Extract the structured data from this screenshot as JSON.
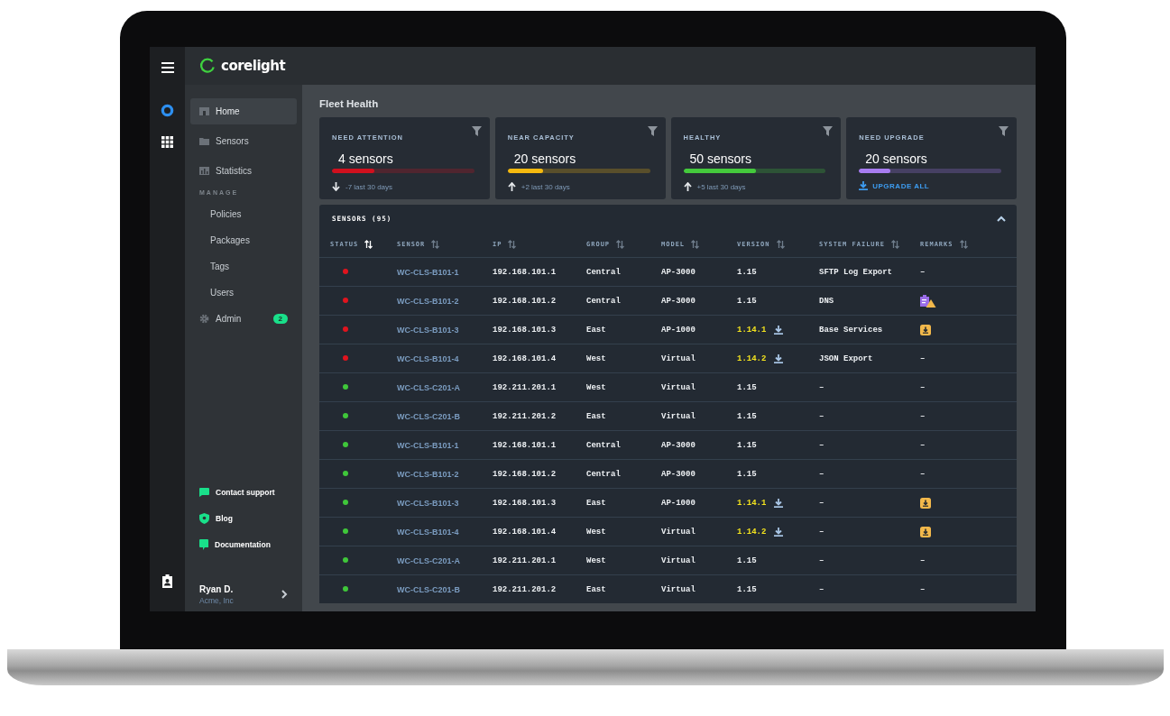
{
  "app": {
    "logo_text": "corelight"
  },
  "sidebar": {
    "items": [
      {
        "kind": "main",
        "label": "Home",
        "selected": true
      },
      {
        "kind": "main",
        "label": "Sensors",
        "selected": false
      },
      {
        "kind": "main",
        "label": "Statistics",
        "selected": false
      },
      {
        "kind": "heading",
        "label": "MANAGE"
      },
      {
        "kind": "sub",
        "label": "Policies",
        "selected": false
      },
      {
        "kind": "sub",
        "label": "Packages",
        "selected": false
      },
      {
        "kind": "sub",
        "label": "Tags",
        "selected": false
      },
      {
        "kind": "sub",
        "label": "Users",
        "selected": false
      },
      {
        "kind": "main",
        "label": "Admin",
        "selected": false,
        "badge": "2"
      }
    ],
    "links": [
      "Contact support",
      "Blog",
      "Documentation"
    ],
    "user": {
      "name": "Ryan D.",
      "org": "Acme, Inc"
    }
  },
  "page_title": "Fleet Health",
  "cards": [
    {
      "title": "NEED ATTENTION",
      "count": "4 sensors",
      "level": 0.3,
      "color": "#d0101e",
      "kind": "trend",
      "rising": false,
      "text": "-7 last 30 days"
    },
    {
      "title": "NEAR CAPACITY",
      "count": "20 sensors",
      "level": 0.25,
      "color": "#f5b90f",
      "kind": "trend",
      "rising": true,
      "text": "+2 last 30 days"
    },
    {
      "title": "HEALTHY",
      "count": "50 sensors",
      "level": 0.51,
      "color": "#44c93c",
      "kind": "trend",
      "rising": true,
      "text": "+5 last 30 days"
    },
    {
      "title": "NEED UPGRADE",
      "count": "20 sensors",
      "level": 0.22,
      "color": "#a77cf0",
      "kind": "action",
      "text": "UPGRADE ALL"
    }
  ],
  "table": {
    "title": "SENSORS (95)",
    "expanded": true,
    "columns": [
      {
        "label": "STATUS",
        "sort_active": true
      },
      {
        "label": "SENSOR",
        "sort_active": false
      },
      {
        "label": "IP",
        "sort_active": false
      },
      {
        "label": "GROUP",
        "sort_active": false
      },
      {
        "label": "MODEL",
        "sort_active": false
      },
      {
        "label": "VERSION",
        "sort_active": false
      },
      {
        "label": "SYSTEM FAILURE",
        "sort_active": false
      },
      {
        "label": "REMARKS",
        "sort_active": false
      }
    ],
    "rows": [
      {
        "color": "#e0141e",
        "sensor": "WC-CLS-B101-1",
        "ip": "192.168.101.1",
        "group": "Central",
        "model": "AP-3000",
        "version": "1.15",
        "outdated": false,
        "failure": "SFTP Log Export",
        "remarks": {
          "kind": "text",
          "text": "–"
        }
      },
      {
        "color": "#e0141e",
        "sensor": "WC-CLS-B101-2",
        "ip": "192.168.101.2",
        "group": "Central",
        "model": "AP-3000",
        "version": "1.15",
        "outdated": false,
        "failure": "DNS",
        "remarks": {
          "kind": "clipboard-warning"
        }
      },
      {
        "color": "#e0141e",
        "sensor": "WC-CLS-B101-3",
        "ip": "192.168.101.3",
        "group": "East",
        "model": "AP-1000",
        "version": "1.14.1",
        "outdated": true,
        "failure": "Base Services",
        "remarks": {
          "kind": "download"
        }
      },
      {
        "color": "#e0141e",
        "sensor": "WC-CLS-B101-4",
        "ip": "192.168.101.4",
        "group": "West",
        "model": "Virtual",
        "version": "1.14.2",
        "outdated": true,
        "failure": "JSON Export",
        "remarks": {
          "kind": "text",
          "text": "–"
        }
      },
      {
        "color": "#3fc73a",
        "sensor": "WC-CLS-C201-A",
        "ip": "192.211.201.1",
        "group": "West",
        "model": "Virtual",
        "version": "1.15",
        "outdated": false,
        "failure": "–",
        "remarks": {
          "kind": "text",
          "text": "–"
        }
      },
      {
        "color": "#3fc73a",
        "sensor": "WC-CLS-C201-B",
        "ip": "192.211.201.2",
        "group": "East",
        "model": "Virtual",
        "version": "1.15",
        "outdated": false,
        "failure": "–",
        "remarks": {
          "kind": "text",
          "text": "–"
        }
      },
      {
        "color": "#3fc73a",
        "sensor": "WC-CLS-B101-1",
        "ip": "192.168.101.1",
        "group": "Central",
        "model": "AP-3000",
        "version": "1.15",
        "outdated": false,
        "failure": "–",
        "remarks": {
          "kind": "text",
          "text": "–"
        }
      },
      {
        "color": "#3fc73a",
        "sensor": "WC-CLS-B101-2",
        "ip": "192.168.101.2",
        "group": "Central",
        "model": "AP-3000",
        "version": "1.15",
        "outdated": false,
        "failure": "–",
        "remarks": {
          "kind": "text",
          "text": "–"
        }
      },
      {
        "color": "#3fc73a",
        "sensor": "WC-CLS-B101-3",
        "ip": "192.168.101.3",
        "group": "East",
        "model": "AP-1000",
        "version": "1.14.1",
        "outdated": true,
        "failure": "–",
        "remarks": {
          "kind": "download"
        }
      },
      {
        "color": "#3fc73a",
        "sensor": "WC-CLS-B101-4",
        "ip": "192.168.101.4",
        "group": "West",
        "model": "Virtual",
        "version": "1.14.2",
        "outdated": true,
        "failure": "–",
        "remarks": {
          "kind": "download"
        }
      },
      {
        "color": "#3fc73a",
        "sensor": "WC-CLS-C201-A",
        "ip": "192.211.201.1",
        "group": "West",
        "model": "Virtual",
        "version": "1.15",
        "outdated": false,
        "failure": "–",
        "remarks": {
          "kind": "text",
          "text": "–"
        }
      },
      {
        "color": "#3fc73a",
        "sensor": "WC-CLS-C201-B",
        "ip": "192.211.201.2",
        "group": "East",
        "model": "Virtual",
        "version": "1.15",
        "outdated": false,
        "failure": "–",
        "remarks": {
          "kind": "text",
          "text": "–"
        }
      }
    ]
  }
}
